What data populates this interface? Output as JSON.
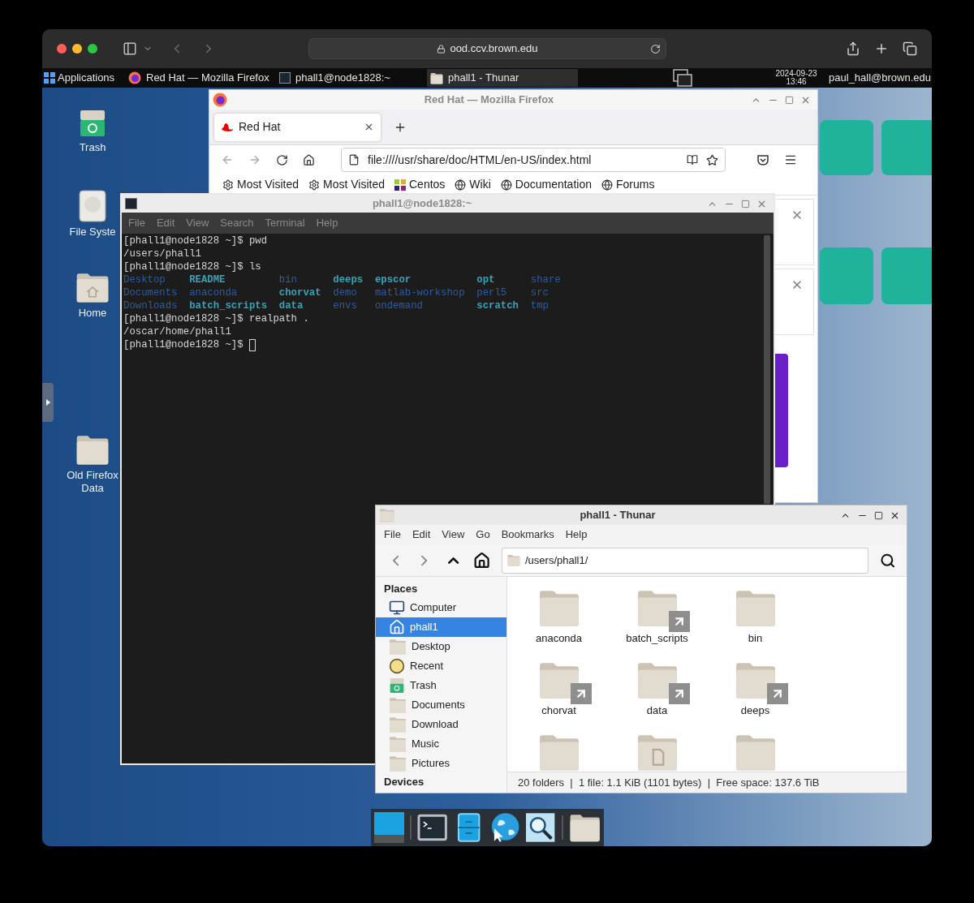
{
  "browser": {
    "url": "ood.ccv.brown.edu"
  },
  "panel": {
    "applications": "Applications",
    "tasks": [
      {
        "label": "Red Hat — Mozilla Firefox",
        "kind": "browser",
        "selected": false
      },
      {
        "label": "phall1@node1828:~",
        "kind": "terminal",
        "selected": false
      },
      {
        "label": "phall1 - Thunar",
        "kind": "folder",
        "selected": true
      }
    ],
    "date": "2024-09-23",
    "time": "13:46",
    "user": "paul_hall@brown.edu"
  },
  "desktop_icons": [
    {
      "label": "Trash",
      "kind": "trash"
    },
    {
      "label": "File Syste",
      "kind": "drive"
    },
    {
      "label": "Home",
      "kind": "home"
    },
    {
      "label": "Old Firefox Data",
      "kind": "folder"
    }
  ],
  "firefox": {
    "title": "Red Hat — Mozilla Firefox",
    "tabs": [
      {
        "label": "Red Hat",
        "selected": true
      }
    ],
    "url": "file:////usr/share/doc/HTML/en-US/index.html",
    "bookmarks": [
      {
        "label": "Most Visited",
        "kind": "gear"
      },
      {
        "label": "Most Visited",
        "kind": "gear"
      },
      {
        "label": "Centos",
        "kind": "pinwheel"
      },
      {
        "label": "Wiki",
        "kind": "globe"
      },
      {
        "label": "Documentation",
        "kind": "globe"
      },
      {
        "label": "Forums",
        "kind": "globe"
      }
    ]
  },
  "terminal": {
    "title": "phall1@node1828:~",
    "menu": [
      "File",
      "Edit",
      "View",
      "Search",
      "Terminal",
      "Help"
    ],
    "lines": [
      {
        "kind": "text",
        "text": "[phall1@node1828 ~]$ pwd"
      },
      {
        "kind": "text",
        "text": "/users/phall1"
      },
      {
        "kind": "text",
        "text": "[phall1@node1828 ~]$ ls"
      },
      {
        "kind": "listing",
        "items": [
          {
            "text": "Desktop",
            "color": "#2b5ca8",
            "bold": false
          },
          {
            "text": "README",
            "color": "#37a3b8",
            "bold": true
          },
          {
            "text": "bin",
            "color": "#2b5ca8",
            "bold": false
          },
          {
            "text": "deeps",
            "color": "#37a3b8",
            "bold": true
          },
          {
            "text": "epscor",
            "color": "#37a3b8",
            "bold": true
          },
          {
            "text": "opt",
            "color": "#37a3b8",
            "bold": true
          },
          {
            "text": "share",
            "color": "#2b5ca8",
            "bold": false
          }
        ]
      },
      {
        "kind": "listing",
        "items": [
          {
            "text": "Documents",
            "color": "#2b5ca8",
            "bold": false
          },
          {
            "text": "anaconda",
            "color": "#2b5ca8",
            "bold": false
          },
          {
            "text": "chorvat",
            "color": "#37a3b8",
            "bold": true
          },
          {
            "text": "demo",
            "color": "#2b5ca8",
            "bold": false
          },
          {
            "text": "matlab-workshop",
            "color": "#2b5ca8",
            "bold": false
          },
          {
            "text": "perl5",
            "color": "#2b5ca8",
            "bold": false
          },
          {
            "text": "src",
            "color": "#2b5ca8",
            "bold": false
          }
        ]
      },
      {
        "kind": "listing",
        "items": [
          {
            "text": "Downloads",
            "color": "#2b5ca8",
            "bold": false
          },
          {
            "text": "batch_scripts",
            "color": "#37a3b8",
            "bold": true
          },
          {
            "text": "data",
            "color": "#37a3b8",
            "bold": true
          },
          {
            "text": "envs",
            "color": "#2b5ca8",
            "bold": false
          },
          {
            "text": "ondemand",
            "color": "#2b5ca8",
            "bold": false
          },
          {
            "text": "scratch",
            "color": "#37a3b8",
            "bold": true
          },
          {
            "text": "tmp",
            "color": "#2b5ca8",
            "bold": false
          }
        ]
      },
      {
        "kind": "text",
        "text": "[phall1@node1828 ~]$ realpath ."
      },
      {
        "kind": "text",
        "text": "/oscar/home/phall1"
      },
      {
        "kind": "prompt",
        "text": "[phall1@node1828 ~]$ "
      }
    ]
  },
  "thunar": {
    "title": "phall1 - Thunar",
    "menu": [
      "File",
      "Edit",
      "View",
      "Go",
      "Bookmarks",
      "Help"
    ],
    "path": "/users/phall1/",
    "sections": [
      {
        "heading": "Places",
        "items": [
          {
            "label": "Computer",
            "kind": "computer",
            "selected": false
          },
          {
            "label": "phall1",
            "kind": "home",
            "selected": true
          },
          {
            "label": "Desktop",
            "kind": "folder",
            "selected": false
          },
          {
            "label": "Recent",
            "kind": "clock",
            "selected": false
          },
          {
            "label": "Trash",
            "kind": "trash",
            "selected": false
          },
          {
            "label": "Documents",
            "kind": "folder",
            "selected": false
          },
          {
            "label": "Download",
            "kind": "folder",
            "selected": false
          },
          {
            "label": "Music",
            "kind": "folder",
            "selected": false
          },
          {
            "label": "Pictures",
            "kind": "folder",
            "selected": false
          }
        ]
      },
      {
        "heading": "Devices"
      }
    ],
    "files": [
      {
        "label": "anaconda",
        "kind": "folder"
      },
      {
        "label": "batch_scripts",
        "kind": "link"
      },
      {
        "label": "bin",
        "kind": "folder"
      },
      {
        "label": "chorvat",
        "kind": "link"
      },
      {
        "label": "data",
        "kind": "link"
      },
      {
        "label": "deeps",
        "kind": "link"
      },
      {
        "kind": "folder"
      },
      {
        "kind": "templates"
      },
      {
        "kind": "folder"
      }
    ],
    "status": "20 folders  |  1 file: 1.1 KiB (1101 bytes)  |  Free space: 137.6 TiB"
  },
  "dock": [
    {
      "kind": "desktop"
    },
    {
      "kind": "terminal"
    },
    {
      "kind": "files"
    },
    {
      "kind": "browser"
    },
    {
      "kind": "search"
    },
    {
      "kind": "folder"
    }
  ]
}
